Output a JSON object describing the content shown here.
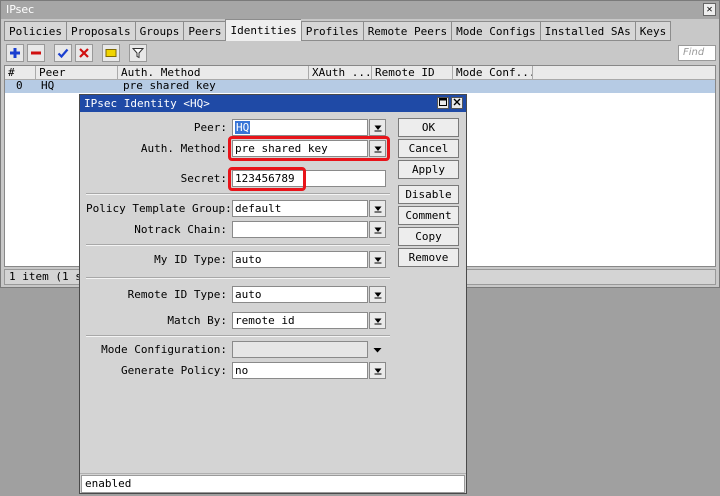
{
  "main_window": {
    "title": "IPsec",
    "close_glyph": "✕",
    "tabs": [
      "Policies",
      "Proposals",
      "Groups",
      "Peers",
      "Identities",
      "Profiles",
      "Remote Peers",
      "Mode Configs",
      "Installed SAs",
      "Keys"
    ],
    "active_tab": "Identities",
    "find_placeholder": "Find",
    "table": {
      "columns": [
        "#",
        "Peer",
        "Auth. Method",
        "XAuth ...",
        "Remote ID",
        "Mode Conf..."
      ],
      "rows": [
        {
          "num": "0",
          "peer": "HQ",
          "auth_method": "pre shared key"
        }
      ]
    },
    "status": "1 item (1 s"
  },
  "toolbar": {
    "icons": [
      "add-icon",
      "remove-icon",
      "enable-icon",
      "disable-icon",
      "comment-icon",
      "filter-icon"
    ],
    "colors": {
      "add": "#1a3fd0",
      "remove": "#d01010",
      "enable": "#1a3fd0",
      "disable": "#d01010",
      "comment": "#e6c400"
    }
  },
  "dialog": {
    "title": "IPsec Identity <HQ>",
    "fields": {
      "peer": {
        "label": "Peer:",
        "value": "HQ"
      },
      "auth_method": {
        "label": "Auth. Method:",
        "value": "pre shared key"
      },
      "secret": {
        "label": "Secret:",
        "value": "123456789"
      },
      "policy_template_group": {
        "label": "Policy Template Group:",
        "value": "default"
      },
      "notrack_chain": {
        "label": "Notrack Chain:",
        "value": ""
      },
      "my_id_type": {
        "label": "My ID Type:",
        "value": "auto"
      },
      "remote_id_type": {
        "label": "Remote ID Type:",
        "value": "auto"
      },
      "match_by": {
        "label": "Match By:",
        "value": "remote id"
      },
      "mode_configuration": {
        "label": "Mode Configuration:",
        "value": ""
      },
      "generate_policy": {
        "label": "Generate Policy:",
        "value": "no"
      }
    },
    "buttons": {
      "ok": "OK",
      "cancel": "Cancel",
      "apply": "Apply",
      "disable": "Disable",
      "comment": "Comment",
      "copy": "Copy",
      "remove": "Remove"
    },
    "status": "enabled",
    "highlight_color": "#e8141a"
  }
}
